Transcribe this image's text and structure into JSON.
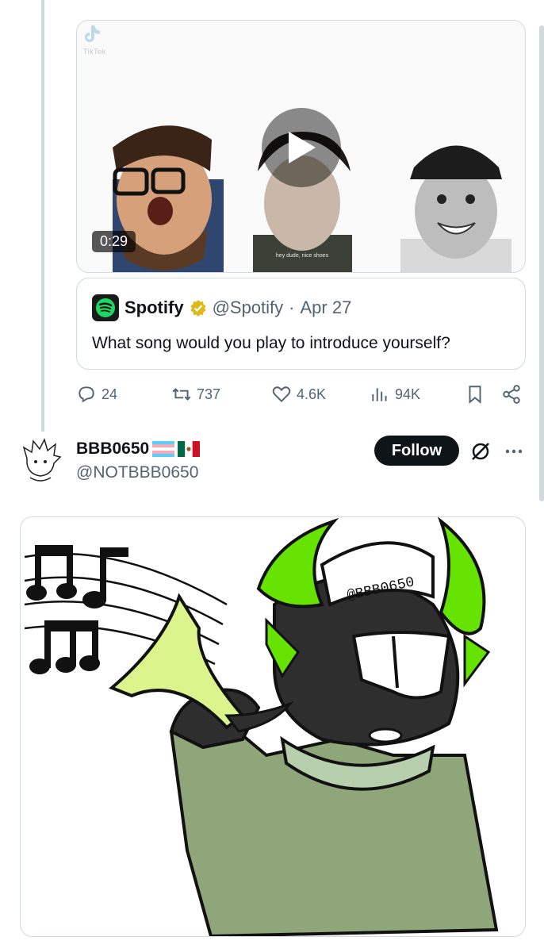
{
  "video": {
    "duration": "0:29",
    "watermark_brand": "TikTok",
    "subtitle": "hey dude, nice shoes"
  },
  "quote": {
    "name": "Spotify",
    "handle": "@Spotify",
    "separator": "·",
    "date": "Apr 27",
    "text": "What song would you play to introduce yourself?"
  },
  "actions": {
    "replies": "24",
    "reposts": "737",
    "likes": "4.6K",
    "views": "94K"
  },
  "user": {
    "name": "BBB0650",
    "flags": [
      "transgender-flag",
      "mexico-flag"
    ],
    "handle": "@NOTBBB0650",
    "follow_label": "Follow"
  },
  "artwork": {
    "helmet_text": "@BBB0650"
  },
  "colors": {
    "text": "#0f1419",
    "secondary": "#536471",
    "border": "#cfd9de",
    "verified_gold": "#e2b719",
    "spotify_green": "#1ed760",
    "horn_green": "#66e400",
    "trumpet": "#dbf58c",
    "sweater": "#8ea67a"
  }
}
